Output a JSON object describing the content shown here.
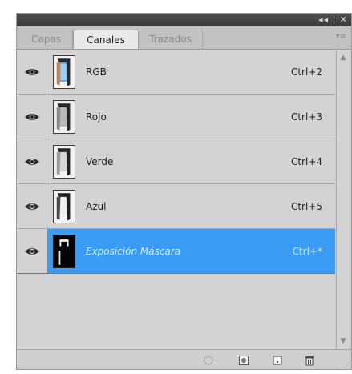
{
  "panel": {
    "window_controls": "◂◂ | ✕",
    "tabs": [
      {
        "label": "Capas",
        "active": false
      },
      {
        "label": "Canales",
        "active": true
      },
      {
        "label": "Trazados",
        "active": false
      }
    ],
    "channels": [
      {
        "name": "RGB",
        "shortcut": "Ctrl+2",
        "selected": false,
        "thumb": "rgb-thumbnail"
      },
      {
        "name": "Rojo",
        "shortcut": "Ctrl+3",
        "selected": false,
        "thumb": "red-thumbnail"
      },
      {
        "name": "Verde",
        "shortcut": "Ctrl+4",
        "selected": false,
        "thumb": "green-thumbnail"
      },
      {
        "name": "Azul",
        "shortcut": "Ctrl+5",
        "selected": false,
        "thumb": "blue-thumbnail"
      },
      {
        "name": "Exposición Máscara",
        "shortcut": "Ctrl+*",
        "selected": true,
        "thumb": "mask-thumbnail"
      }
    ],
    "colors": {
      "selection": "#3a9cf2",
      "panel_bg": "#d3d3d3",
      "titlebar": "#424242"
    },
    "bottom_icons": [
      "load-selection-icon",
      "save-selection-icon",
      "new-channel-icon",
      "delete-channel-icon"
    ]
  }
}
